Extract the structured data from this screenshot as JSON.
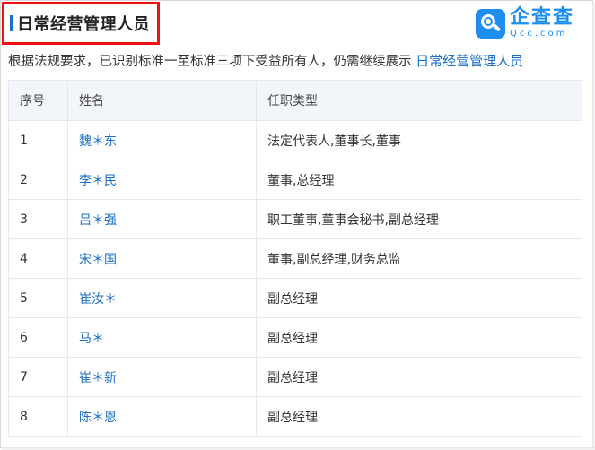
{
  "header": {
    "title": "日常经营管理人员",
    "logo_cn": "企查查",
    "logo_en": "Qcc.com"
  },
  "notice": {
    "text": "根据法规要求，已识别标准一至标准三项下受益所有人，仍需继续展示 ",
    "link": "日常经营管理人员"
  },
  "table": {
    "columns": [
      "序号",
      "姓名",
      "任职类型"
    ],
    "rows": [
      {
        "index": "1",
        "name": "魏＊东",
        "role": "法定代表人,董事长,董事"
      },
      {
        "index": "2",
        "name": "李＊民",
        "role": "董事,总经理"
      },
      {
        "index": "3",
        "name": "吕＊强",
        "role": "职工董事,董事会秘书,副总经理"
      },
      {
        "index": "4",
        "name": "宋＊国",
        "role": "董事,副总经理,财务总监"
      },
      {
        "index": "5",
        "name": "崔汝＊",
        "role": "副总经理"
      },
      {
        "index": "6",
        "name": "马＊",
        "role": "副总经理"
      },
      {
        "index": "7",
        "name": "崔＊新",
        "role": "副总经理"
      },
      {
        "index": "8",
        "name": "陈＊恩",
        "role": "副总经理"
      }
    ]
  },
  "colors": {
    "highlight": "#ee1111",
    "accent": "#1b6fc4",
    "logo": "#1f8ef1"
  }
}
